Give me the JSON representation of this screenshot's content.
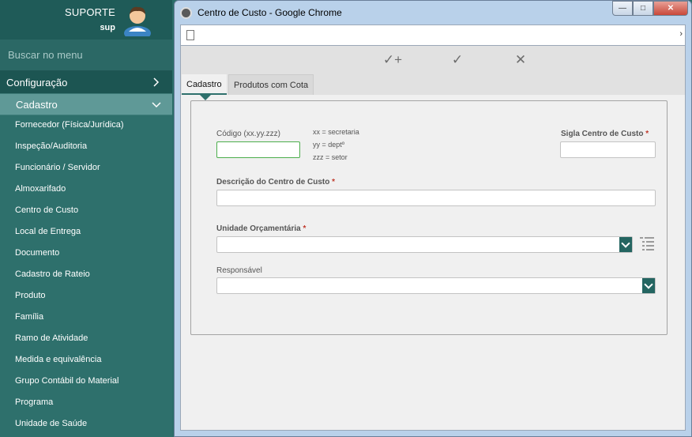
{
  "sidebar": {
    "user_name": "SUPORTE",
    "user_login": "sup",
    "search_placeholder": "Buscar no menu",
    "section": "Configuração",
    "subsection": "Cadastro",
    "items": [
      "Fornecedor (Física/Jurídica)",
      "Inspeção/Auditoria",
      "Funcionário / Servidor",
      "Almoxarifado",
      "Centro de Custo",
      "Local de Entrega",
      "Documento",
      "Cadastro de Rateio",
      "Produto",
      "Família",
      "Ramo de Atividade",
      "Medida e equivalência",
      "Grupo Contábil do Material",
      "Programa",
      "Unidade de Saúde"
    ]
  },
  "window": {
    "title": "Centro de Custo - Google Chrome",
    "controls": {
      "minimize": "—",
      "maximize": "□",
      "close": "✕"
    }
  },
  "toolbar": {
    "save_new_icon": "check-plus-icon",
    "save_icon": "check-icon",
    "cancel_icon": "x-icon",
    "save_new": "✓+",
    "save": "✓",
    "cancel": "✕"
  },
  "tabs": [
    {
      "label": "Cadastro",
      "active": true
    },
    {
      "label": "Produtos com Cota",
      "active": false
    }
  ],
  "form": {
    "codigo_label": "Código (xx.yy.zzz)",
    "codigo_value": "",
    "hints": [
      "xx = secretaria",
      "yy = deptº",
      "zzz = setor"
    ],
    "sigla_label": "Sigla Centro de Custo",
    "sigla_value": "",
    "descricao_label": "Descrição do Centro de Custo",
    "descricao_value": "",
    "unidade_label": "Unidade Orçamentária",
    "unidade_value": "",
    "responsavel_label": "Responsável",
    "responsavel_value": "",
    "required_marker": "*"
  },
  "colors": {
    "sidebar_bg": "#2e706c",
    "accent": "#246561",
    "required": "#c0392b",
    "focus_border": "#4cae4c"
  }
}
